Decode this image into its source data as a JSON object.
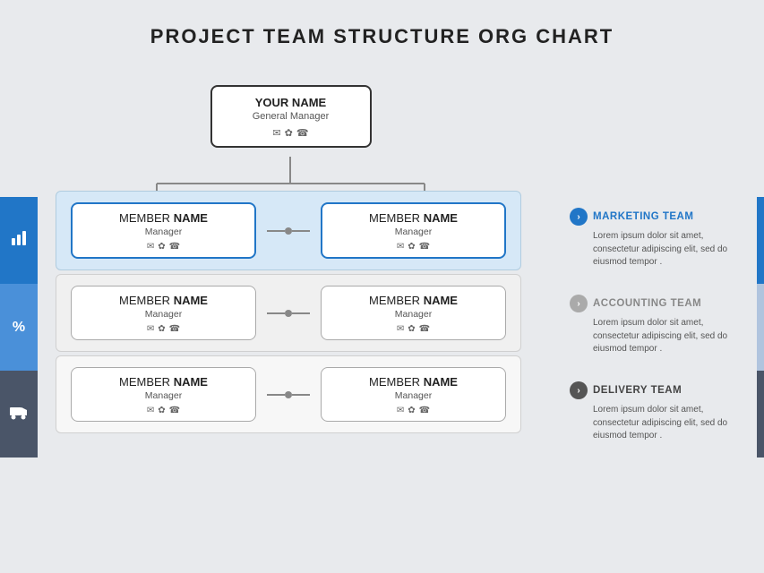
{
  "title": "PROJECT TEAM STRUCTURE ORG CHART",
  "top_node": {
    "name": "YOUR NAME",
    "role": "General Manager",
    "icons": [
      "✉",
      "🐦",
      "📞"
    ]
  },
  "rows": [
    {
      "bg": "blue",
      "left": {
        "name_prefix": "MEMBER ",
        "name_bold": "NAME",
        "role": "Manager",
        "icons": [
          "✉",
          "🐦",
          "📞"
        ]
      },
      "right": {
        "name_prefix": "MEMBER ",
        "name_bold": "NAME",
        "role": "Manager",
        "icons": [
          "✉",
          "🐦",
          "📞"
        ]
      }
    },
    {
      "bg": "gray",
      "left": {
        "name_prefix": "MEMBER ",
        "name_bold": "NAME",
        "role": "Manager",
        "icons": [
          "✉",
          "🐦",
          "📞"
        ]
      },
      "right": {
        "name_prefix": "MEMBER ",
        "name_bold": "NAME",
        "role": "Manager",
        "icons": [
          "✉",
          "🐦",
          "📞"
        ]
      }
    },
    {
      "bg": "white",
      "left": {
        "name_prefix": "MEMBER ",
        "name_bold": "NAME",
        "role": "Manager",
        "icons": [
          "✉",
          "🐦",
          "📞"
        ]
      },
      "right": {
        "name_prefix": "MEMBER ",
        "name_bold": "NAME",
        "role": "Manager",
        "icons": [
          "✉",
          "🐦",
          "📞"
        ]
      }
    }
  ],
  "sidebar_icons": [
    "📊",
    "%",
    "🚚"
  ],
  "info_panels": [
    {
      "title": "MARKETING TEAM",
      "title_class": "title-blue",
      "chevron_class": "chevron-blue",
      "text": "Lorem ipsum dolor sit amet, consectetur adipiscing elit, sed do eiusmod tempor ."
    },
    {
      "title": "ACCOUNTING TEAM",
      "title_class": "title-gray",
      "chevron_class": "chevron-gray",
      "text": "Lorem ipsum dolor sit amet, consectetur adipiscing elit, sed do eiusmod tempor ."
    },
    {
      "title": "DELIVERY TEAM",
      "title_class": "title-dark",
      "chevron_class": "chevron-dark",
      "text": "Lorem ipsum dolor sit amet, consectetur adipiscing elit, sed do eiusmod tempor ."
    }
  ]
}
